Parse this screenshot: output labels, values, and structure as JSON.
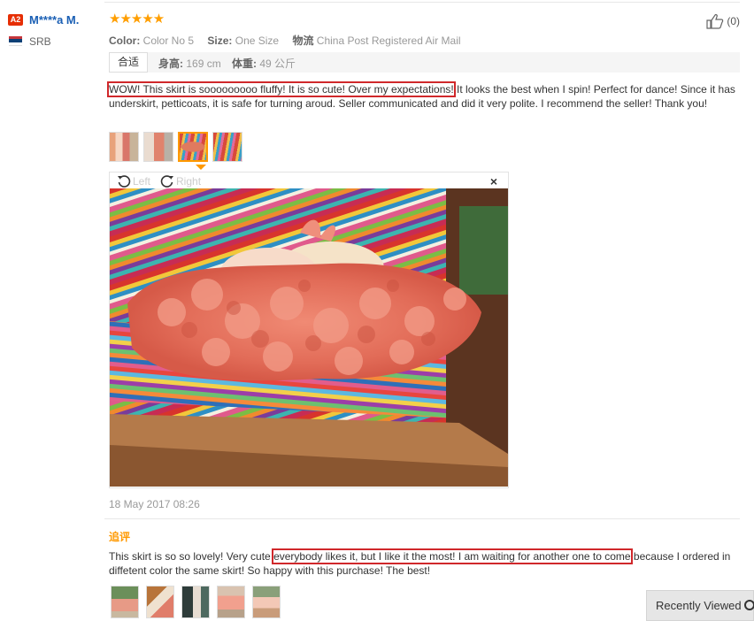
{
  "reviewer": {
    "level_badge": "A2",
    "name": "M****a M.",
    "country": "SRB"
  },
  "review": {
    "stars": "★★★★★",
    "rating": 5,
    "helpful_count": "(0)",
    "props": [
      {
        "label": "Color:",
        "value": "Color No 5"
      },
      {
        "label": "Size:",
        "value": "One Size"
      },
      {
        "label": "物流",
        "value": "China Post Registered Air Mail"
      }
    ],
    "fit": {
      "label": "合适",
      "height_label": "身高:",
      "height_value": "169 cm",
      "weight_label": "体重:",
      "weight_value": "49 公斤"
    },
    "text_highlight": "WOW! This skirt is sooooooooo fluffy! It is so cute! Over my expectations!",
    "text_rest": " It looks the best when I spin! Perfect for dance! Since it has underskirt, petticoats, it is safe for turning aroud. Seller communicated and did it very polite. I recommend the seller! Thank you!",
    "viewer": {
      "left_label": "Left",
      "right_label": "Right",
      "close": "×"
    },
    "date": "18 May 2017 08:26"
  },
  "additional": {
    "label": "追评",
    "text_before": "This skirt is so so lovely! Very cute ",
    "text_highlight": "everybody likes it, but I like it the most! I am waiting for another one to come",
    "text_after": " because I ordered in diffetent color the same skirt! So happy with this purchase! The best!"
  },
  "recently_viewed": "Recently Viewed",
  "colors": {
    "accent": "#ff9900",
    "highlight_border": "#d0282b",
    "name_link": "#1a5fb4",
    "badge": "#e62e04"
  }
}
